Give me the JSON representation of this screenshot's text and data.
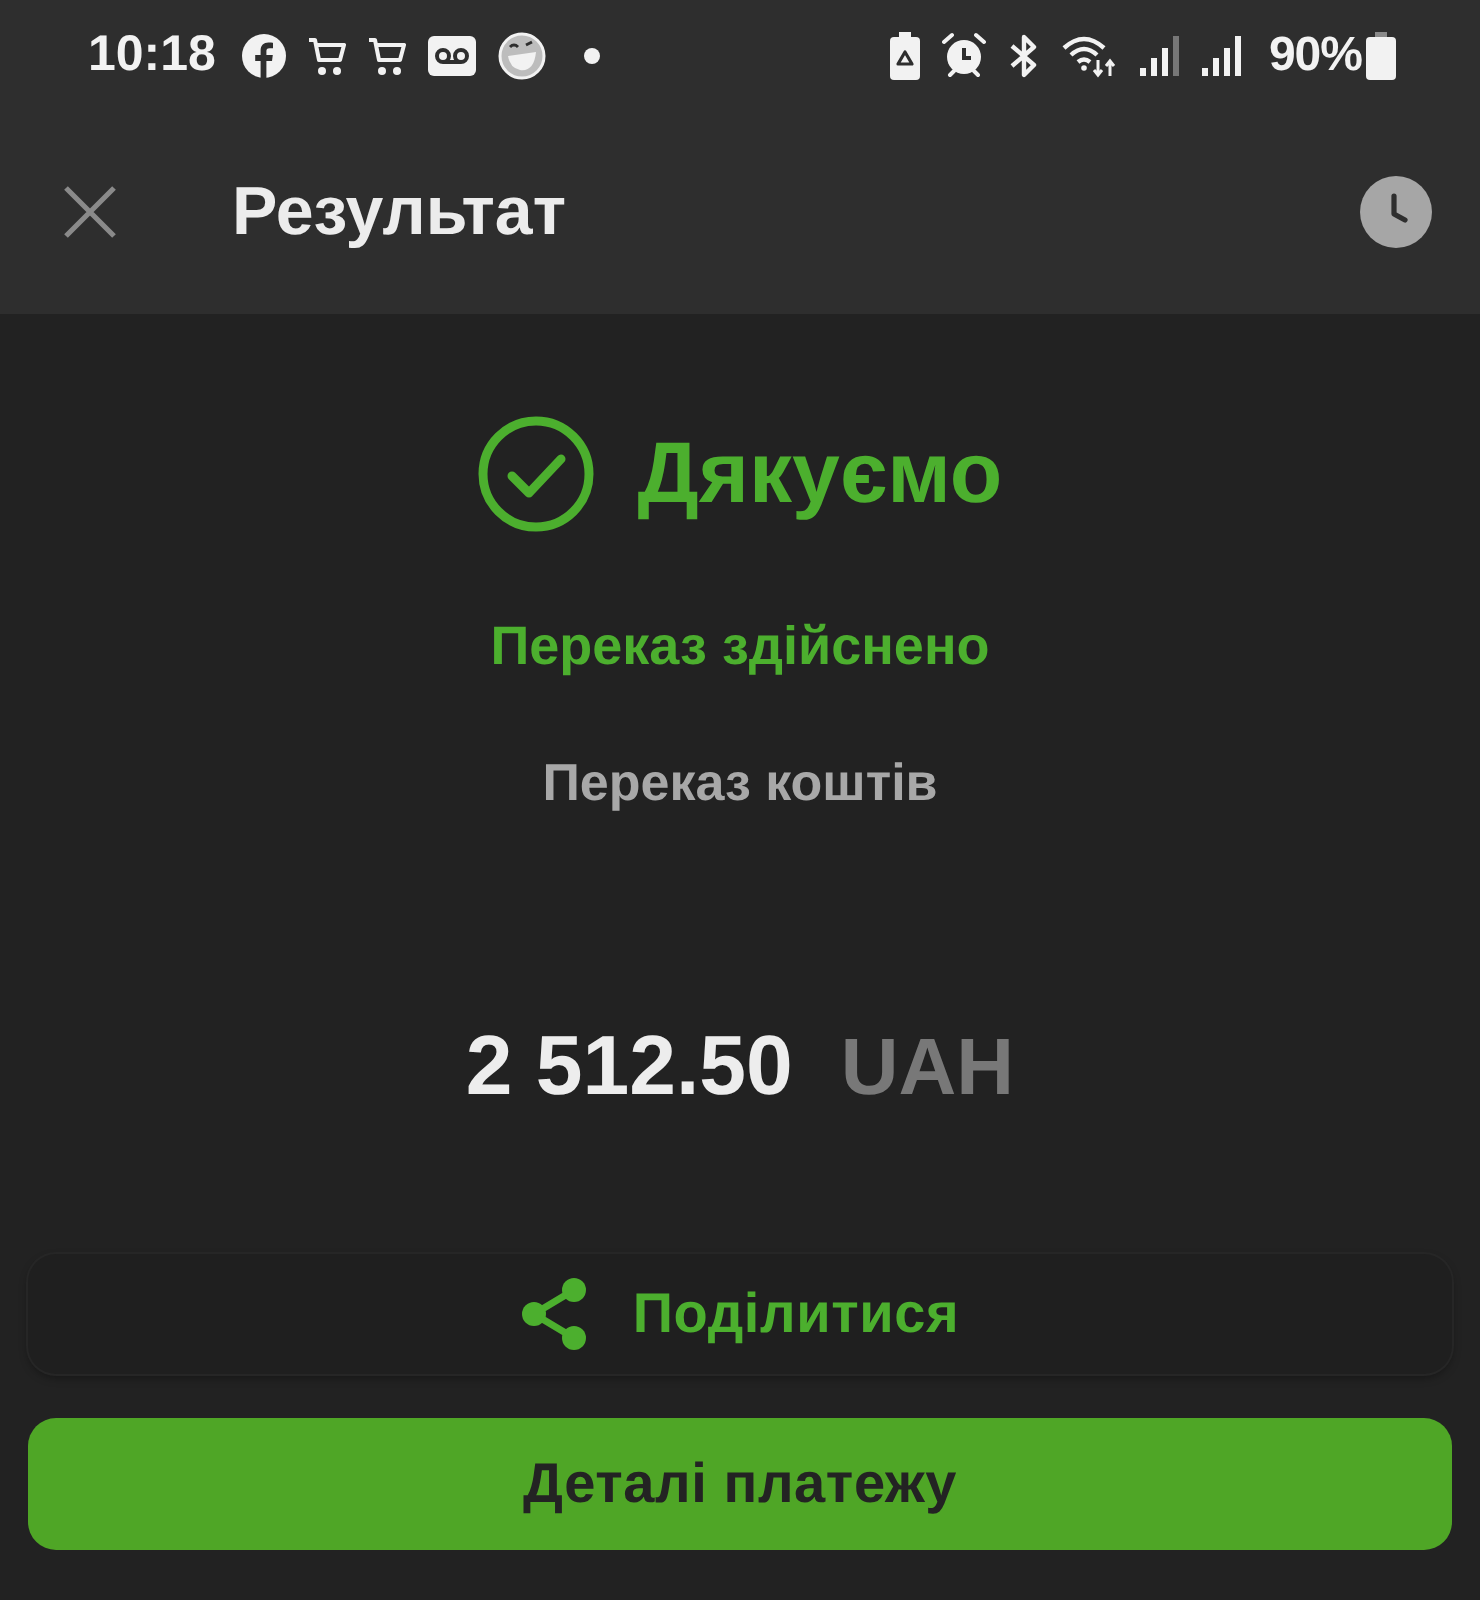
{
  "status_bar": {
    "time": "10:18",
    "battery": "90%"
  },
  "header": {
    "title": "Результат"
  },
  "result": {
    "kind": "success",
    "heading": "Дякуємо",
    "status_text": "Переказ здійснено",
    "operation": "Переказ коштів",
    "amount": "2 512.50",
    "currency": "UAH"
  },
  "actions": [
    {
      "kind": "secondary",
      "label": "Поділитися"
    },
    {
      "kind": "primary",
      "label": "Деталі платежу"
    }
  ]
}
